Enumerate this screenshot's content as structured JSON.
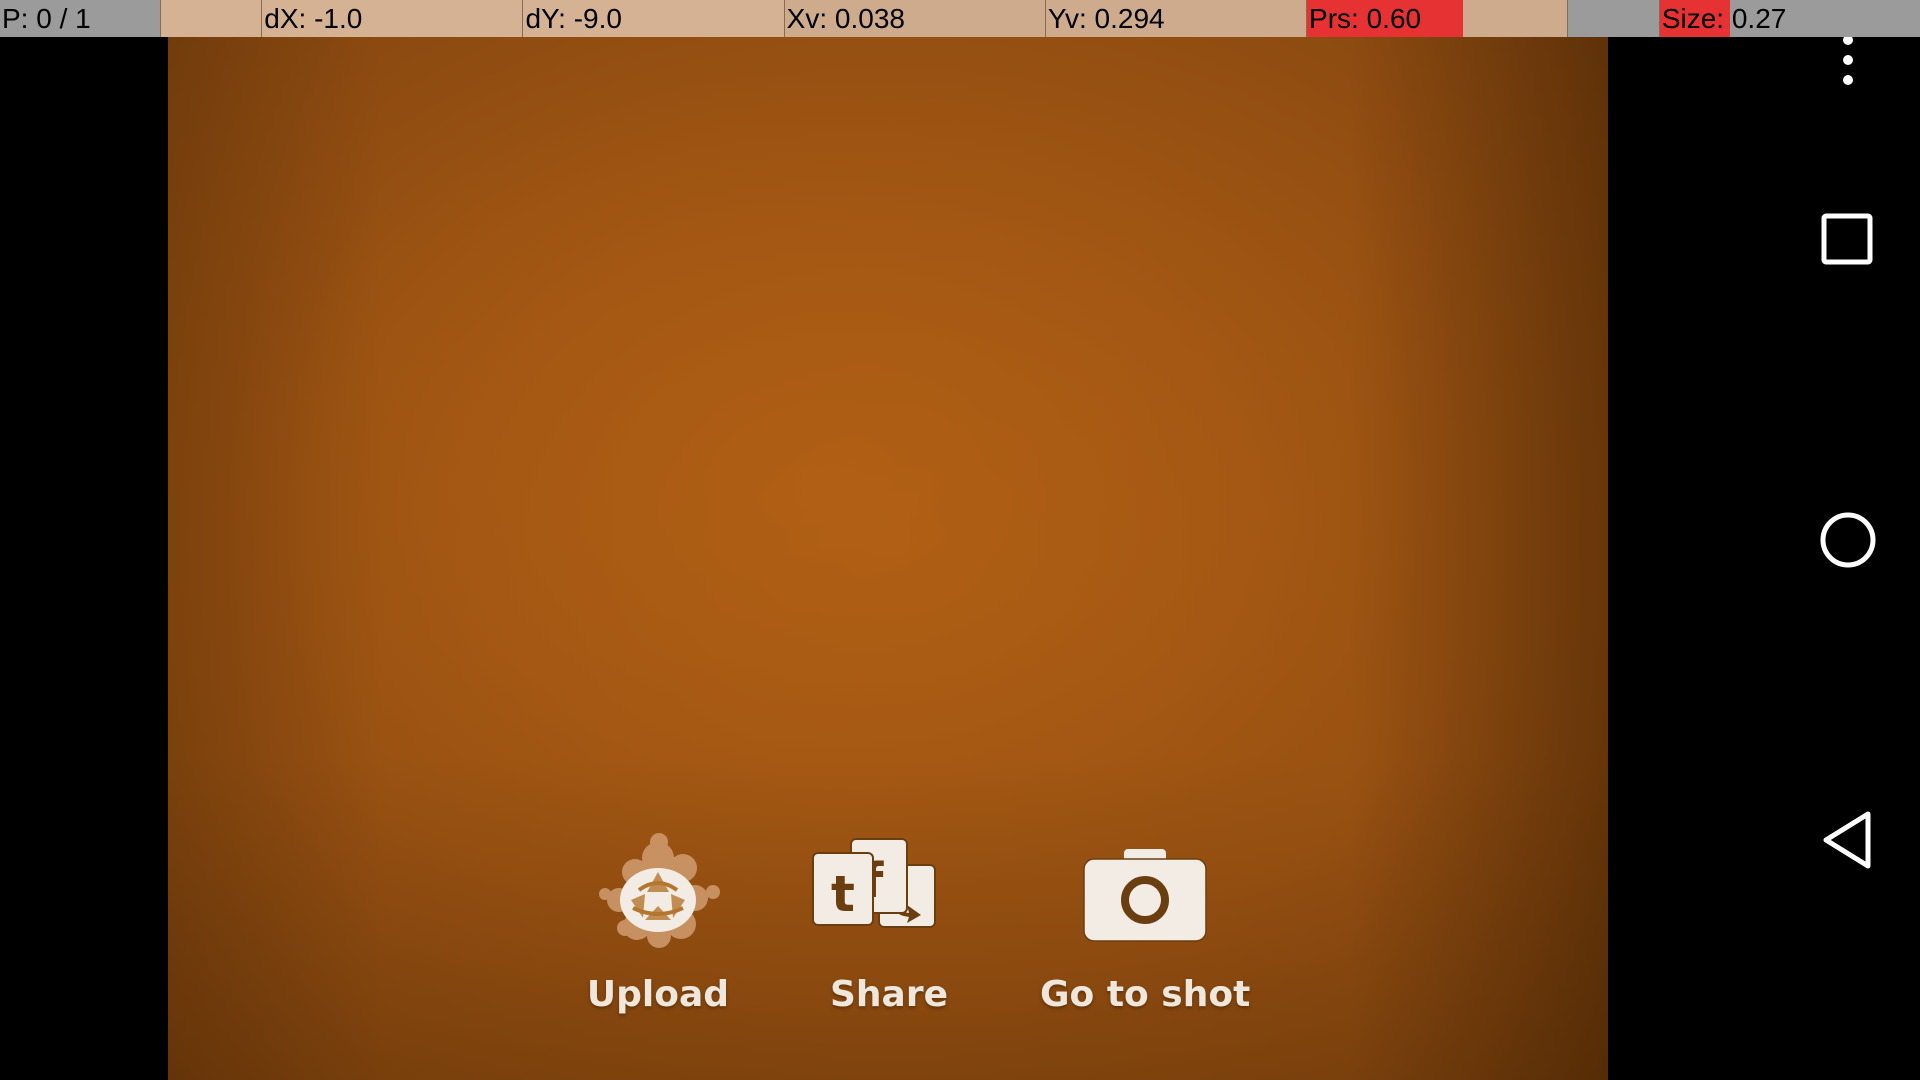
{
  "pointer_overlay": {
    "pointers": "P: 0 / 1",
    "dx": "dX: -1.0",
    "dy": "dY: -9.0",
    "xv": "Xv: 0.038",
    "yv": "Yv: 0.294",
    "pressure": "Prs: 0.60",
    "size": "Size: 0.27",
    "pressure_value": 0.6,
    "size_value": 0.27,
    "colors": {
      "gray": "#9b9b9b",
      "tan": "#d6b294",
      "red": "#e63232"
    }
  },
  "app": {
    "background_color": "#a85b13",
    "actions": [
      {
        "label": "Upload",
        "icon": "upload-icon"
      },
      {
        "label": "Share",
        "icon": "share-social-icon"
      },
      {
        "label": "Go to shot",
        "icon": "camera-icon"
      }
    ]
  },
  "nav_bar": {
    "buttons": [
      {
        "icon": "overflow-menu-icon"
      },
      {
        "icon": "recents-square-icon"
      },
      {
        "icon": "home-circle-icon"
      },
      {
        "icon": "back-triangle-icon"
      }
    ]
  }
}
